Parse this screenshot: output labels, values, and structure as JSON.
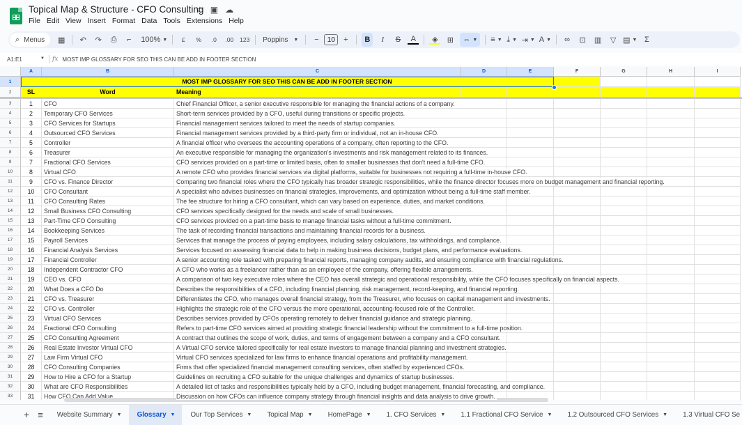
{
  "app": {
    "doc_title": "Topical Map & Structure -  CFO Consulting",
    "title_icons": [
      "star-icon",
      "move-to-folder-icon",
      "cloud-status-icon"
    ],
    "menu": [
      "File",
      "Edit",
      "View",
      "Insert",
      "Format",
      "Data",
      "Tools",
      "Extensions",
      "Help"
    ]
  },
  "toolbar": {
    "menus_label": "Menus",
    "zoom": "100%",
    "currency": "£",
    "percent": "%",
    "decrease_decimal": ".0",
    "increase_decimal": ".00",
    "more_formats": "123",
    "font": "Poppins",
    "font_size": "10",
    "minus": "−",
    "plus": "+",
    "bold": "B",
    "italic": "I",
    "strike": "S",
    "text_color": "A",
    "sum": "Σ"
  },
  "formula_bar": {
    "name_box": "A1:E1",
    "fx": "fx",
    "content": "MOST IMP GLOSSARY FOR SEO THIS CAN BE ADD IN FOOTER SECTION"
  },
  "columns": [
    "A",
    "B",
    "C",
    "D",
    "E",
    "F",
    "G",
    "H",
    "I"
  ],
  "sheet": {
    "title_row": "MOST IMP GLOSSARY FOR SEO THIS CAN BE ADD IN FOOTER SECTION",
    "headers": {
      "sl": "SL",
      "word": "Word",
      "meaning": "Meaning"
    },
    "rows": [
      {
        "n": "3",
        "sl": "1",
        "word": "CFO",
        "meaning": "Chief Financial Officer, a senior executive responsible for managing the financial actions of a company."
      },
      {
        "n": "4",
        "sl": "2",
        "word": "Temporary CFO Services",
        "meaning": "Short-term services provided by a CFO, useful during transitions or specific projects."
      },
      {
        "n": "5",
        "sl": "3",
        "word": "CFO Services for Startups",
        "meaning": "Financial management services tailored to meet the needs of startup companies."
      },
      {
        "n": "6",
        "sl": "4",
        "word": "Outsourced CFO Services",
        "meaning": "Financial management services provided by a third-party firm or individual, not an in-house CFO."
      },
      {
        "n": "7",
        "sl": "5",
        "word": "Controller",
        "meaning": "A financial officer who oversees the accounting operations of a company, often reporting to the CFO."
      },
      {
        "n": "8",
        "sl": "6",
        "word": "Treasurer",
        "meaning": "An executive responsible for managing the organization's investments and risk management related to its finances."
      },
      {
        "n": "9",
        "sl": "7",
        "word": "Fractional CFO Services",
        "meaning": "CFO services provided on a part-time or limited basis, often to smaller businesses that don't need a full-time CFO."
      },
      {
        "n": "10",
        "sl": "8",
        "word": "Virtual CFO",
        "meaning": "A remote CFO who provides financial services via digital platforms, suitable for businesses not requiring a full-time in-house CFO."
      },
      {
        "n": "11",
        "sl": "9",
        "word": "CFO vs. Finance Director",
        "meaning": "Comparing two financial roles where the CFO typically has broader strategic responsibilities, while the finance director focuses more on budget management and financial reporting."
      },
      {
        "n": "12",
        "sl": "10",
        "word": "CFO Consultant",
        "meaning": "A specialist who advises businesses on financial strategies, improvements, and optimization without being a full-time staff member."
      },
      {
        "n": "13",
        "sl": "11",
        "word": "CFO Consulting Rates",
        "meaning": "The fee structure for hiring a CFO consultant, which can vary based on experience, duties, and market conditions."
      },
      {
        "n": "14",
        "sl": "12",
        "word": "Small Business CFO Consulting",
        "meaning": "CFO services specifically designed for the needs and scale of small businesses."
      },
      {
        "n": "15",
        "sl": "13",
        "word": "Part-Time CFO Consulting",
        "meaning": "CFO services provided on a part-time basis to manage financial tasks without a full-time commitment."
      },
      {
        "n": "16",
        "sl": "14",
        "word": "Bookkeeping Services",
        "meaning": "The task of recording financial transactions and maintaining financial records for a business."
      },
      {
        "n": "17",
        "sl": "15",
        "word": "Payroll Services",
        "meaning": "Services that manage the process of paying employees, including salary calculations, tax withholdings, and compliance."
      },
      {
        "n": "18",
        "sl": "16",
        "word": "Financial Analysis Services",
        "meaning": "Services focused on assessing financial data to help in making business decisions, budget plans, and performance evaluations."
      },
      {
        "n": "19",
        "sl": "17",
        "word": "Financial Controller",
        "meaning": "A senior accounting role tasked with preparing financial reports, managing company audits, and ensuring compliance with financial regulations."
      },
      {
        "n": "20",
        "sl": "18",
        "word": "Independent Contractor CFO",
        "meaning": "A CFO who works as a freelancer rather than as an employee of the company, offering flexible arrangements."
      },
      {
        "n": "21",
        "sl": "19",
        "word": "CEO vs. CFO",
        "meaning": "A comparison of two key executive roles where the CEO has overall strategic and operational responsibility, while the CFO focuses specifically on financial aspects."
      },
      {
        "n": "22",
        "sl": "20",
        "word": "What Does a CFO Do",
        "meaning": "Describes the responsibilities of a CFO, including financial planning, risk management, record-keeping, and financial reporting."
      },
      {
        "n": "23",
        "sl": "21",
        "word": "CFO vs. Treasurer",
        "meaning": "Differentiates the CFO, who manages overall financial strategy, from the Treasurer, who focuses on capital management and investments."
      },
      {
        "n": "24",
        "sl": "22",
        "word": "CFO vs. Controller",
        "meaning": "Highlights the strategic role of the CFO versus the more operational, accounting-focused role of the Controller."
      },
      {
        "n": "25",
        "sl": "23",
        "word": "Virtual CFO Services",
        "meaning": "Describes services provided by CFOs operating remotely to deliver financial guidance and strategic planning."
      },
      {
        "n": "26",
        "sl": "24",
        "word": "Fractional CFO Consulting",
        "meaning": "Refers to part-time CFO services aimed at providing strategic financial leadership without the commitment to a full-time position."
      },
      {
        "n": "27",
        "sl": "25",
        "word": "CFO Consulting Agreement",
        "meaning": "A contract that outlines the scope of work, duties, and terms of engagement between a company and a CFO consultant."
      },
      {
        "n": "28",
        "sl": "26",
        "word": "Real Estate Investor Virtual CFO",
        "meaning": "A Virtual CFO service tailored specifically for real estate investors to manage financial planning and investment strategies."
      },
      {
        "n": "29",
        "sl": "27",
        "word": "Law Firm Virtual CFO",
        "meaning": "Virtual CFO services specialized for law firms to enhance financial operations and profitability management."
      },
      {
        "n": "30",
        "sl": "28",
        "word": "CFO Consulting Companies",
        "meaning": "Firms that offer specialized financial management consulting services, often staffed by experienced CFOs."
      },
      {
        "n": "31",
        "sl": "29",
        "word": "How to Hire a CFO for a Startup",
        "meaning": "Guidelines on recruiting a CFO suitable for the unique challenges and dynamics of startup businesses."
      },
      {
        "n": "32",
        "sl": "30",
        "word": "What are CFO Responsibilities",
        "meaning": "A detailed list of tasks and responsibilities typically held by a CFO, including budget management, financial forecasting, and compliance."
      },
      {
        "n": "33",
        "sl": "31",
        "word": "How CFO Can Add Value",
        "meaning": "Discussion on how CFOs can influence company strategy through financial insights and data analysis to drive growth."
      }
    ]
  },
  "tabs": {
    "add_label": "+",
    "all_label": "≡",
    "items": [
      {
        "label": "Website Summary",
        "active": false
      },
      {
        "label": "Glossary",
        "active": true
      },
      {
        "label": "Our Top Services",
        "active": false
      },
      {
        "label": "Topical Map",
        "active": false
      },
      {
        "label": "HomePage",
        "active": false
      },
      {
        "label": "1. CFO Services",
        "active": false
      },
      {
        "label": "1.1 Fractional CFO Service",
        "active": false
      },
      {
        "label": "1.2 Outsourced CFO Services",
        "active": false
      },
      {
        "label": "1.3 Virtual CFO Se",
        "active": false
      }
    ]
  },
  "colors": {
    "highlight": "#ffff00",
    "selection": "#1a73e8",
    "active_tab": "#0b57d0",
    "sheets_green": "#0f9d58"
  }
}
